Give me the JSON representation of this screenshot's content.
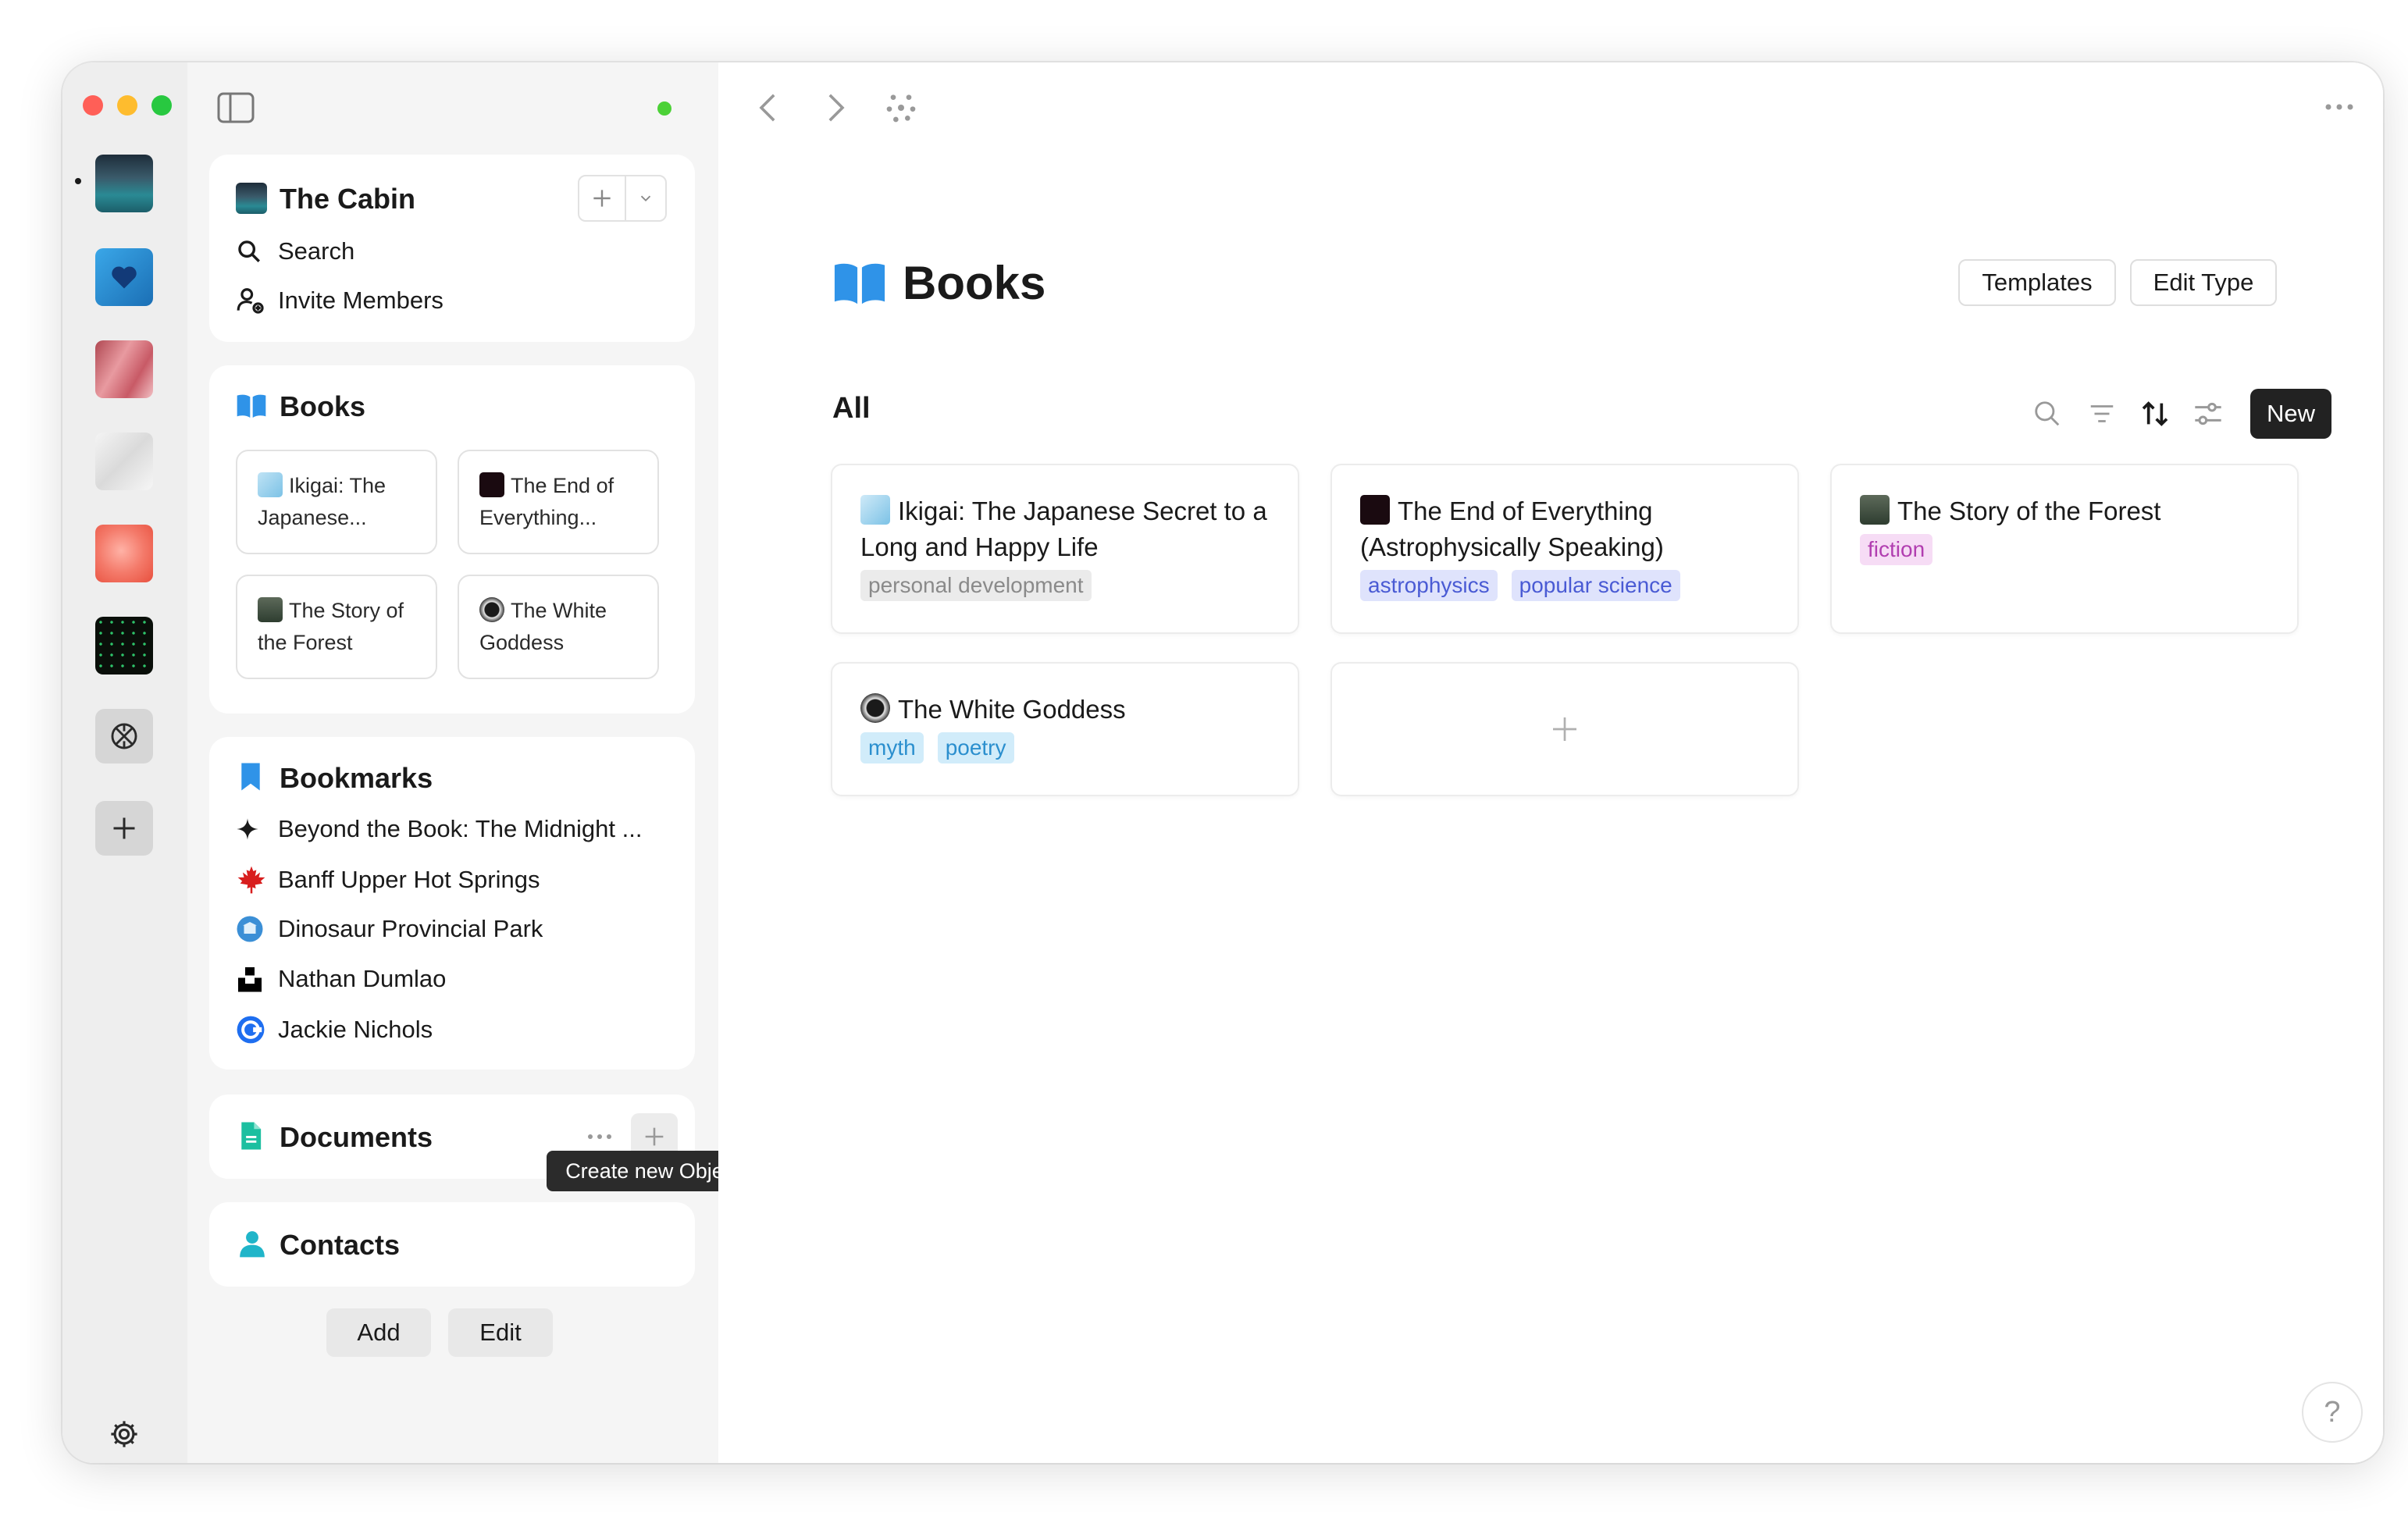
{
  "window": {
    "title": "Books"
  },
  "rail": {
    "spaces": [
      {
        "name": "The Cabin",
        "active": true
      },
      {
        "name": "Heart space"
      },
      {
        "name": "Pink feathers"
      },
      {
        "name": "White fabric"
      },
      {
        "name": "Coral flower"
      },
      {
        "name": "Dark stars"
      }
    ]
  },
  "sidebar": {
    "space": {
      "name": "The Cabin",
      "search_label": "Search",
      "invite_label": "Invite Members"
    },
    "books_widget": {
      "title": "Books",
      "items": [
        {
          "label": "Ikigai: The Japanese..."
        },
        {
          "label": "The End of Everything..."
        },
        {
          "label": "The Story of the Forest"
        },
        {
          "label": "The White Goddess"
        }
      ]
    },
    "bookmarks_widget": {
      "title": "Bookmarks",
      "items": [
        {
          "label": "Beyond the Book: The Midnight ...",
          "icon": "sparkle-icon"
        },
        {
          "label": "Banff Upper Hot Springs",
          "icon": "maple-leaf-icon"
        },
        {
          "label": "Dinosaur Provincial Park",
          "icon": "unesco-icon"
        },
        {
          "label": "Nathan Dumlao",
          "icon": "unsplash-icon"
        },
        {
          "label": "Jackie Nichols",
          "icon": "c-logo-icon"
        }
      ]
    },
    "documents_widget": {
      "title": "Documents",
      "tooltip": "Create new Object"
    },
    "contacts_widget": {
      "title": "Contacts"
    },
    "footer": {
      "add_label": "Add",
      "edit_label": "Edit"
    }
  },
  "main": {
    "title": "Books",
    "templates_label": "Templates",
    "edit_type_label": "Edit Type",
    "view_label": "All",
    "new_label": "New",
    "objects": [
      {
        "title": "Ikigai: The Japanese Secret to a Long and Happy Life",
        "tags": [
          "personal development"
        ]
      },
      {
        "title": "The End of Everything (Astrophysically Speaking)",
        "tags": [
          "astrophysics",
          "popular science"
        ]
      },
      {
        "title": "The Story of the Forest",
        "tags": [
          "fiction"
        ]
      },
      {
        "title": "The White Goddess",
        "tags": [
          "myth",
          "poetry"
        ]
      }
    ],
    "help_label": "?"
  },
  "colors": {
    "accent_blue": "#2f93e8",
    "tag_gray": "#ebebeb",
    "tag_indigo": "#dfe3fc",
    "tag_purple": "#f6dcf5",
    "tag_cyan": "#d1ecfa",
    "status_green": "#4cd137",
    "documents_green": "#1cbfa0",
    "contacts_teal": "#20b5c9",
    "new_button_bg": "#222222"
  }
}
